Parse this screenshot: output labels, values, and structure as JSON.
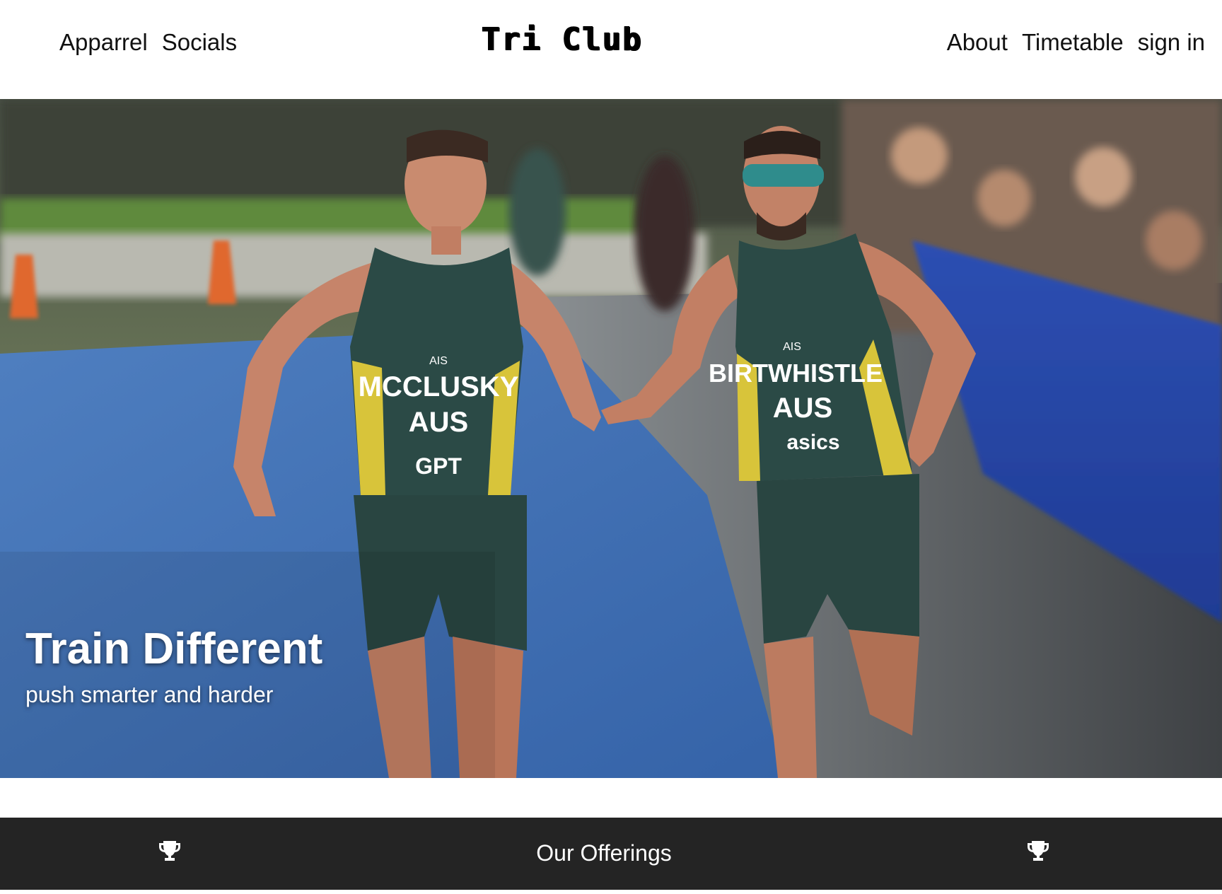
{
  "header": {
    "nav_left": [
      "Apparrel",
      "Socials"
    ],
    "brand": "Tri Club",
    "nav_right": [
      "About",
      "Timetable",
      "sign in"
    ]
  },
  "hero": {
    "title": "Train Different",
    "subtitle": "push smarter and harder",
    "photo_text": {
      "athlete_left_name": "MCCLUSKY",
      "athlete_left_country": "AUS",
      "athlete_left_sponsor": "GPT",
      "athlete_right_name": "BIRTWHISTLE",
      "athlete_right_country": "AUS",
      "athlete_right_sponsor": "asics",
      "badge": "AIS"
    }
  },
  "offerings": {
    "title": "Our Offerings",
    "icon": "trophy-icon"
  },
  "colors": {
    "offerings_bg": "#242424",
    "track_blue": "#3f6fb4",
    "kit_green": "#2a4a45",
    "kit_yellow": "#d9c63a"
  }
}
